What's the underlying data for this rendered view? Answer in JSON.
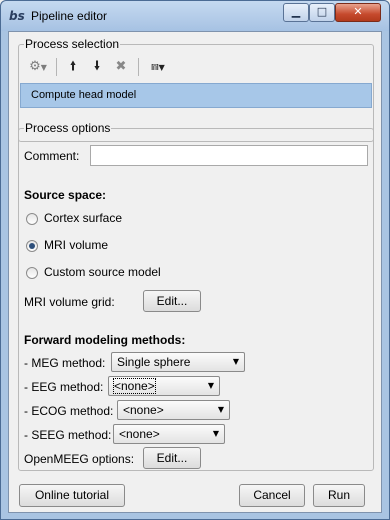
{
  "window": {
    "title": "Pipeline editor",
    "app_icon": "bs-logo-icon"
  },
  "process_selection": {
    "title": "Process selection",
    "toolbar": {
      "icons": [
        "gear-icon",
        "arrow-up-icon",
        "arrow-down-icon",
        "delete-icon",
        "pipeline-tree-icon"
      ]
    },
    "processes": [
      "Compute head model"
    ]
  },
  "process_options": {
    "title": "Process options",
    "comment_label": "Comment:",
    "comment_value": "",
    "source_space_label": "Source space:",
    "source_options": [
      "Cortex surface",
      "MRI volume",
      "Custom source model"
    ],
    "selected_source": "MRI volume",
    "mri_grid_label": "MRI volume grid:",
    "edit_label": "Edit...",
    "forward_label": "Forward modeling methods:",
    "meg_label": "- MEG method:",
    "meg_value": "Single sphere",
    "eeg_label": "- EEG method:",
    "eeg_value": "<none>",
    "ecog_label": "- ECOG method:",
    "ecog_value": "<none>",
    "seeg_label": "- SEEG method:",
    "seeg_value": "<none>",
    "openmeeg_label": "OpenMEEG options:"
  },
  "footer": {
    "tutorial_button": "Online tutorial",
    "cancel_button": "Cancel",
    "run_button": "Run"
  }
}
